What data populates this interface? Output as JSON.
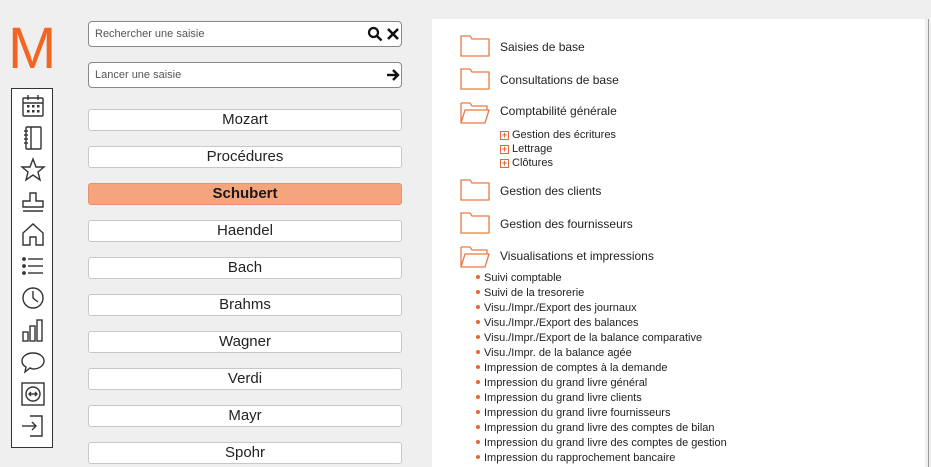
{
  "app": {
    "logo_letter": "M",
    "accent_color": "#f26522"
  },
  "rail_icons": [
    "calendar-icon",
    "notebook-icon",
    "star-icon",
    "stamp-icon",
    "home-icon",
    "list-icon",
    "clock-icon",
    "bar-chart-icon",
    "chat-icon",
    "transfer-icon",
    "exit-icon"
  ],
  "search": {
    "placeholder": "Rechercher une saisie",
    "value": ""
  },
  "launch": {
    "placeholder": "Lancer une saisie",
    "value": ""
  },
  "workspaces": {
    "items": [
      "Mozart",
      "Procédures",
      "Schubert",
      "Haendel",
      "Bach",
      "Brahms",
      "Wagner",
      "Verdi",
      "Mayr",
      "Spohr"
    ],
    "active": "Schubert"
  },
  "menu": {
    "saisies_de_base": "Saisies de base",
    "consultations_de_base": "Consultations de base",
    "comptabilite_generale": {
      "label": "Comptabilité générale",
      "children": [
        "Gestion des écritures",
        "Lettrage",
        "Clôtures"
      ]
    },
    "gestion_des_clients": "Gestion des clients",
    "gestion_des_fournisseurs": "Gestion des fournisseurs",
    "visualisations": {
      "label": "Visualisations et impressions",
      "items": [
        "Suivi comptable",
        "Suivi de la tresorerie",
        "Visu./Impr./Export des journaux",
        "Visu./Impr./Export des balances",
        "Visu./Impr./Export de la balance comparative",
        "Visu./Impr. de la balance agée",
        "Impression de comptes à la demande",
        "Impression du grand livre général",
        "Impression du grand livre clients",
        "Impression du grand livre fournisseurs",
        "Impression du grand livre des comptes de bilan",
        "Impression du grand livre des comptes de gestion",
        "Impression du rapprochement bancaire"
      ]
    }
  }
}
